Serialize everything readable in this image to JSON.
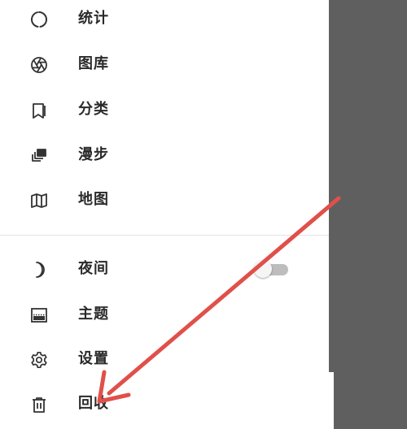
{
  "menu": {
    "items": [
      {
        "label": "统计",
        "icon": "stats-ring-icon"
      },
      {
        "label": "图库",
        "icon": "aperture-icon"
      },
      {
        "label": "分类",
        "icon": "bookmark-icon"
      },
      {
        "label": "漫步",
        "icon": "slides-stack-icon"
      },
      {
        "label": "地图",
        "icon": "map-icon"
      }
    ],
    "settings_items": [
      {
        "label": "夜间",
        "icon": "moon-icon",
        "toggle_on": false
      },
      {
        "label": "主题",
        "icon": "theme-icon"
      },
      {
        "label": "设置",
        "icon": "gear-icon"
      },
      {
        "label": "回收",
        "icon": "trash-icon"
      }
    ]
  },
  "colors": {
    "text": "#2a2a2a",
    "icon": "#333333",
    "scrim": "#5f5f5f",
    "annotation_arrow": "#e0504a"
  }
}
